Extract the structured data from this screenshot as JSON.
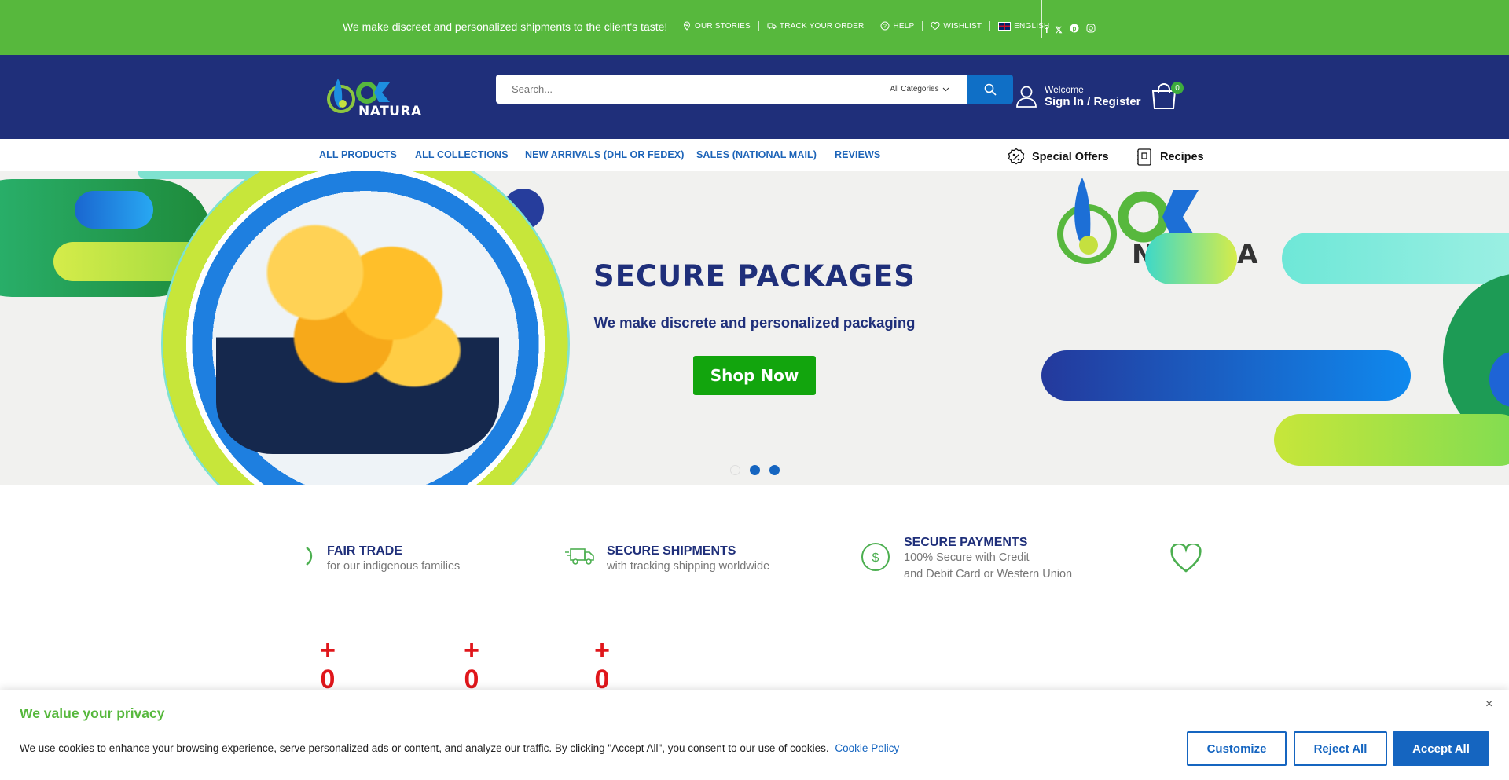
{
  "topbar": {
    "tagline": "We make discreet and personalized shipments to the client's taste!",
    "links": [
      {
        "label": "OUR STORIES",
        "icon": "map-pin-icon"
      },
      {
        "label": "TRACK YOUR ORDER",
        "icon": "truck-icon"
      },
      {
        "label": "HELP",
        "icon": "help-circle-icon"
      },
      {
        "label": "WISHLIST",
        "icon": "heart-icon"
      },
      {
        "label": "ENGLISH",
        "icon": "uk-flag-icon"
      }
    ],
    "social": [
      "facebook-icon",
      "x-icon",
      "pinterest-icon",
      "instagram-icon"
    ],
    "bg_color": "#57b83d"
  },
  "header": {
    "logo_text": "NATURA",
    "search_placeholder": "Search...",
    "category_label": "All Categories",
    "welcome": "Welcome",
    "sign_in": "Sign In / Register",
    "cart_count": "0",
    "bg_color": "#1f2f7a"
  },
  "nav": {
    "items": [
      "ALL PRODUCTS",
      "ALL COLLECTIONS",
      "NEW ARRIVALS (DHL OR FEDEX)",
      "SALES (NATIONAL MAIL)",
      "REVIEWS"
    ],
    "special_offers": "Special Offers",
    "recipes": "Recipes"
  },
  "hero": {
    "title": "SECURE PACKAGES",
    "subtitle": "We make discrete and personalized packaging",
    "button": "Shop Now",
    "logo_text": "NATURA",
    "slide_count": 3
  },
  "features": [
    {
      "title": "FAIR TRADE",
      "lines": [
        "for our indigenous families"
      ]
    },
    {
      "title": "SECURE SHIPMENTS",
      "lines": [
        "with tracking shipping worldwide"
      ]
    },
    {
      "title": "SECURE PAYMENTS",
      "lines": [
        "100% Secure with Credit",
        "and Debit Card or Western Union"
      ]
    }
  ],
  "counters": [
    {
      "plus": "+",
      "value": "0"
    },
    {
      "plus": "+",
      "value": "0"
    },
    {
      "plus": "+",
      "value": "0"
    }
  ],
  "cookie": {
    "title": "We value your privacy",
    "text": "We use cookies to enhance your browsing experience, serve personalized ads or content, and analyze our traffic. By clicking \"Accept All\", you consent to our use of cookies.",
    "policy_link": "Cookie Policy",
    "close": "×",
    "customize": "Customize",
    "reject": "Reject All",
    "accept": "Accept All"
  }
}
